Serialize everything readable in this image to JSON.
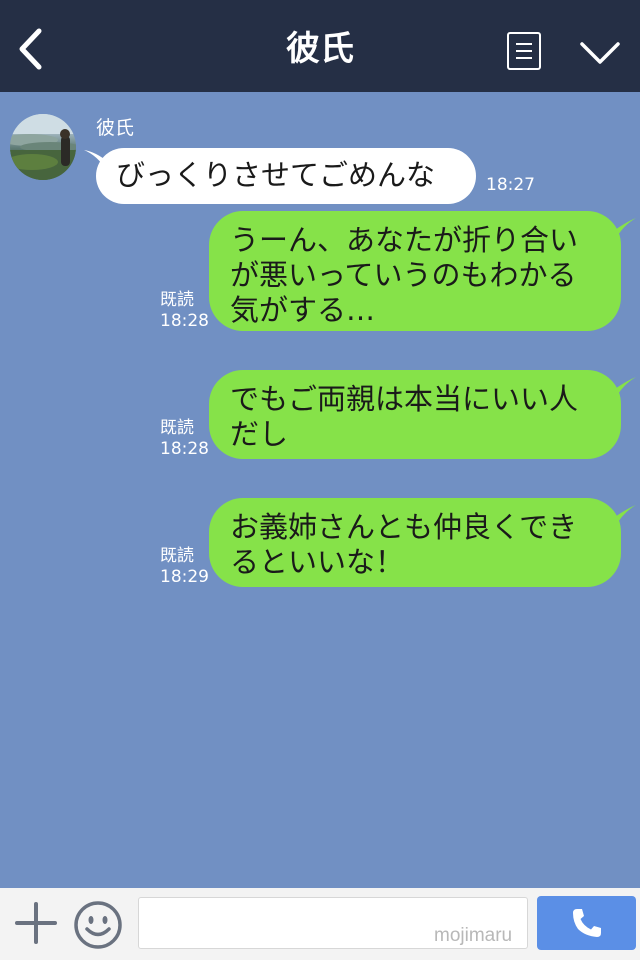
{
  "header": {
    "title": "彼氏",
    "back_icon": "chevron-left-icon",
    "menu_icon": "list-icon",
    "dropdown_icon": "chevron-down-icon",
    "background": "#252f45"
  },
  "chat": {
    "background": "#7190c3",
    "incoming_bubble_color": "#ffffff",
    "outgoing_bubble_color": "#86e249",
    "messages": [
      {
        "direction": "incoming",
        "sender": "彼氏",
        "lines": [
          "びっくりさせてごめんな"
        ],
        "time": "18:27"
      },
      {
        "direction": "outgoing",
        "lines": [
          "うーん、あなたが折り合い",
          "が悪いっていうのもわかる",
          "気がする…"
        ],
        "read": "既読",
        "time": "18:28"
      },
      {
        "direction": "outgoing",
        "lines": [
          "でもご両親は本当にいい人",
          "だし"
        ],
        "read": "既読",
        "time": "18:28"
      },
      {
        "direction": "outgoing",
        "lines": [
          "お義姉さんとも仲良くでき",
          "るといいな！"
        ],
        "read": "既読",
        "time": "18:29"
      }
    ]
  },
  "input_bar": {
    "plus_icon": "plus-icon",
    "emoji_icon": "smiley-icon",
    "call_icon": "phone-icon",
    "placeholder": "",
    "watermark": "mojimaru",
    "call_button_color": "#5b8fe6"
  }
}
